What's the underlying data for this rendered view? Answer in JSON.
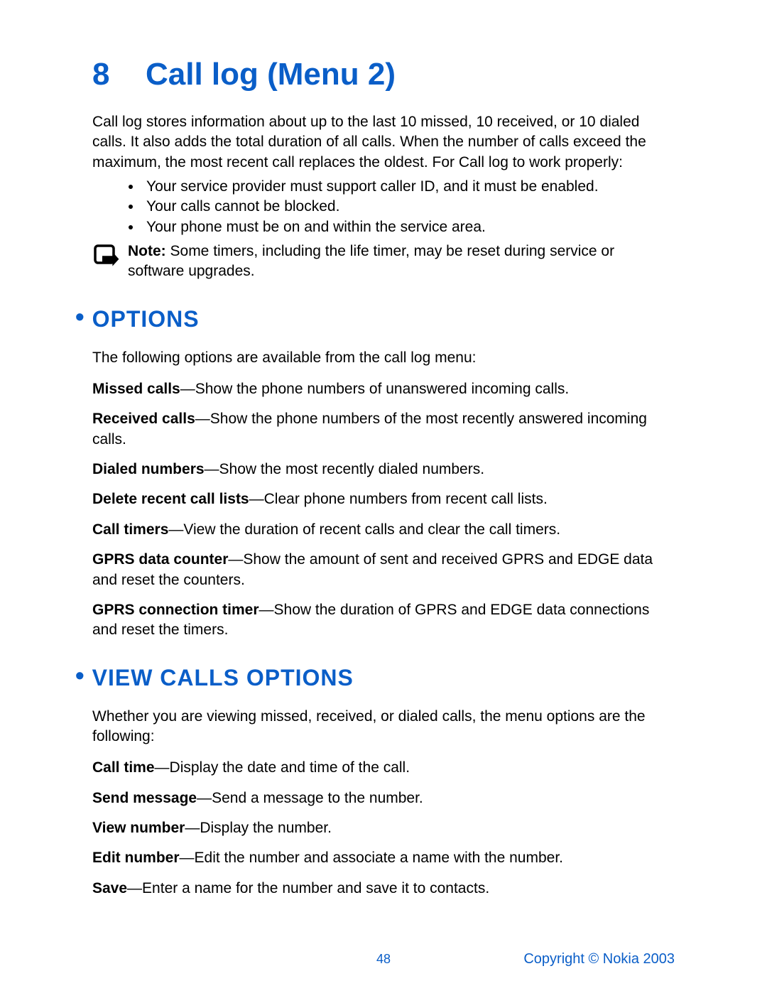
{
  "chapter": {
    "number": "8",
    "title": "Call log (Menu 2)"
  },
  "intro": "Call log stores information about up to the last 10 missed, 10 received, or 10 dialed calls. It also adds the total duration of all calls. When the number of calls exceed the maximum, the most recent call replaces the oldest. For Call log to work properly:",
  "requirements": [
    "Your service provider must support caller ID, and it must be enabled.",
    "Your calls cannot be blocked.",
    "Your phone must be on and within the service area."
  ],
  "note": {
    "label": "Note:",
    "text": " Some timers, including the life timer, may be reset during service or software upgrades."
  },
  "sections": {
    "options": {
      "heading": "OPTIONS",
      "intro": "The following options are available from the call log menu:",
      "items": [
        {
          "term": "Missed calls",
          "desc": "—Show the phone numbers of unanswered incoming calls."
        },
        {
          "term": "Received calls",
          "desc": "—Show the phone numbers of the most recently answered incoming calls."
        },
        {
          "term": "Dialed numbers",
          "desc": "—Show the most recently dialed numbers."
        },
        {
          "term": "Delete recent call lists",
          "desc": "—Clear phone numbers from recent call lists."
        },
        {
          "term": "Call timers",
          "desc": "—View the duration of recent calls and clear the call timers."
        },
        {
          "term": "GPRS data counter",
          "desc": "—Show the amount of sent and received GPRS and EDGE data and reset the counters."
        },
        {
          "term": "GPRS connection timer",
          "desc": "—Show the duration of GPRS and EDGE data connections and reset the timers."
        }
      ]
    },
    "view_calls": {
      "heading": "VIEW CALLS OPTIONS",
      "intro": "Whether you are viewing missed, received, or dialed calls, the menu options are the following:",
      "items": [
        {
          "term": "Call time",
          "desc": "—Display the date and time of the call."
        },
        {
          "term": "Send message",
          "desc": "—Send a message to the number."
        },
        {
          "term": "View number",
          "desc": "—Display the number."
        },
        {
          "term": "Edit number",
          "desc": "—Edit the number and associate a name with the number."
        },
        {
          "term": "Save",
          "desc": "—Enter a name for the number and save it to contacts."
        }
      ]
    }
  },
  "footer": {
    "page": "48",
    "copyright": "Copyright © Nokia 2003"
  }
}
